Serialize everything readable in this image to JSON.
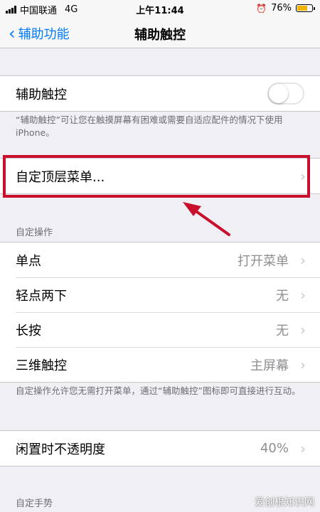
{
  "status": {
    "carrier": "中国联通",
    "network": "4G",
    "time": "上午11:44",
    "alarm": "⏰",
    "battery": "76%",
    "battery_level": 0.76
  },
  "nav": {
    "back_label": "辅助功能",
    "title": "辅助触控"
  },
  "assistive_touch": {
    "label": "辅助触控",
    "enabled": false
  },
  "footnote1": "“辅助触控”可让您在触摸屏幕有困难或需要自适应配件的情况下使用 iPhone。",
  "top_menu": {
    "label": "自定顶层菜单..."
  },
  "custom_actions": {
    "header": "自定操作",
    "items": [
      {
        "label": "单点",
        "value": "打开菜单"
      },
      {
        "label": "轻点两下",
        "value": "无"
      },
      {
        "label": "长按",
        "value": "无"
      },
      {
        "label": "三维触控",
        "value": "主屏幕"
      }
    ],
    "footnote": "自定操作允许您无需打开菜单，通过“辅助触控”图标即可直接进行互动。"
  },
  "idle_opacity": {
    "label": "闲置时不透明度",
    "value": "40%"
  },
  "custom_gestures": {
    "header": "自定手势"
  },
  "watermark": "爱创根知识网",
  "colors": {
    "accent": "#007aff",
    "highlight": "#c8102e"
  }
}
